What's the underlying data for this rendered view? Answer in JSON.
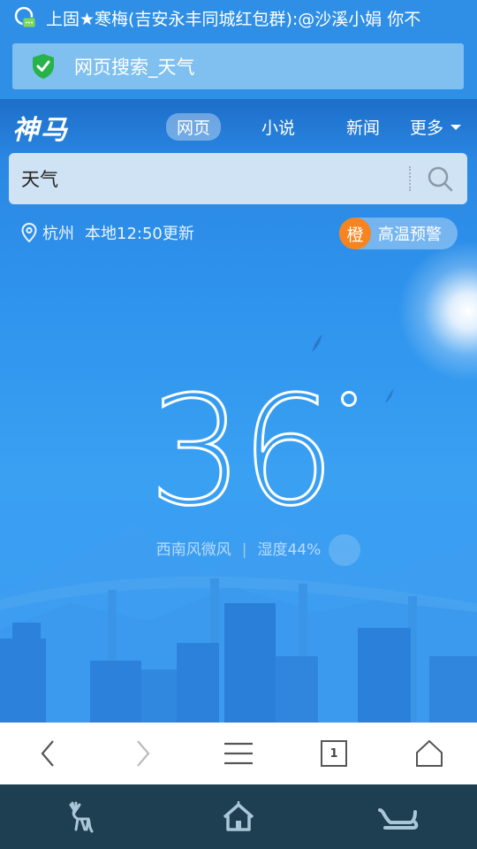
{
  "status_bar": {
    "notification": "上固★寒梅(吉安永丰同城红包群):@沙溪小娟 你不"
  },
  "url_bar": {
    "title": "网页搜索_天气"
  },
  "header": {
    "logo": "神马",
    "tabs": [
      {
        "label": "网页",
        "active": true
      },
      {
        "label": "小说",
        "active": false
      },
      {
        "label": "新闻",
        "active": false
      }
    ],
    "more_label": "更多"
  },
  "search": {
    "query": "天气"
  },
  "weather": {
    "city": "杭州",
    "update_text": "本地12:50更新",
    "alert_level": "橙",
    "alert_text": "高温预警",
    "temperature": "36",
    "wind": "西南风微风",
    "humidity": "湿度44%"
  },
  "colors": {
    "accent_blue": "#2f8fe6",
    "alert_orange": "#f7841f",
    "bottom_nav": "#1e3f52"
  },
  "toolbar": {
    "tab_count": "1"
  }
}
